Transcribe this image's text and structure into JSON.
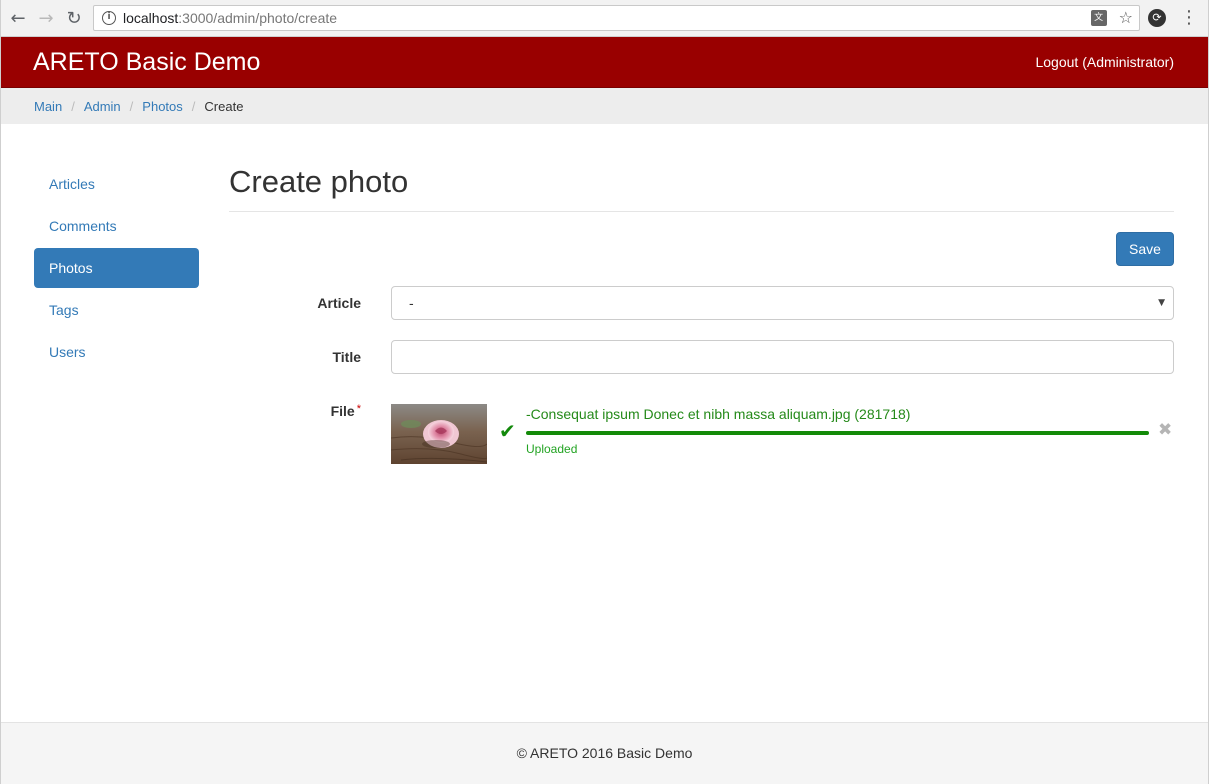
{
  "browser": {
    "url_host": "localhost",
    "url_rest": ":3000/admin/photo/create"
  },
  "navbar": {
    "brand": "ARETO Basic Demo",
    "logout": "Logout (Administrator)"
  },
  "breadcrumb": {
    "items": [
      "Main",
      "Admin",
      "Photos"
    ],
    "current": "Create"
  },
  "sidebar": {
    "items": [
      {
        "label": "Articles",
        "active": false
      },
      {
        "label": "Comments",
        "active": false
      },
      {
        "label": "Photos",
        "active": true
      },
      {
        "label": "Tags",
        "active": false
      },
      {
        "label": "Users",
        "active": false
      }
    ]
  },
  "main": {
    "title": "Create photo",
    "save_label": "Save",
    "form": {
      "article_label": "Article",
      "article_value": "-",
      "title_label": "Title",
      "title_value": "",
      "file_label": "File",
      "file_required_mark": "*",
      "file_name": "-Consequat ipsum Donec et nibh massa aliquam.jpg (281718)",
      "file_progress": 1.0,
      "file_status": "Uploaded"
    }
  },
  "footer": {
    "text": "© ARETO 2016 Basic Demo"
  },
  "colors": {
    "navbar": "#990000",
    "primary": "#337ab7",
    "success": "#138a08"
  },
  "icons": [
    "back-arrow-icon",
    "forward-arrow-icon",
    "reload-icon",
    "info-icon",
    "translate-icon",
    "star-icon",
    "extension-icon",
    "menu-icon",
    "check-icon",
    "remove-icon"
  ]
}
